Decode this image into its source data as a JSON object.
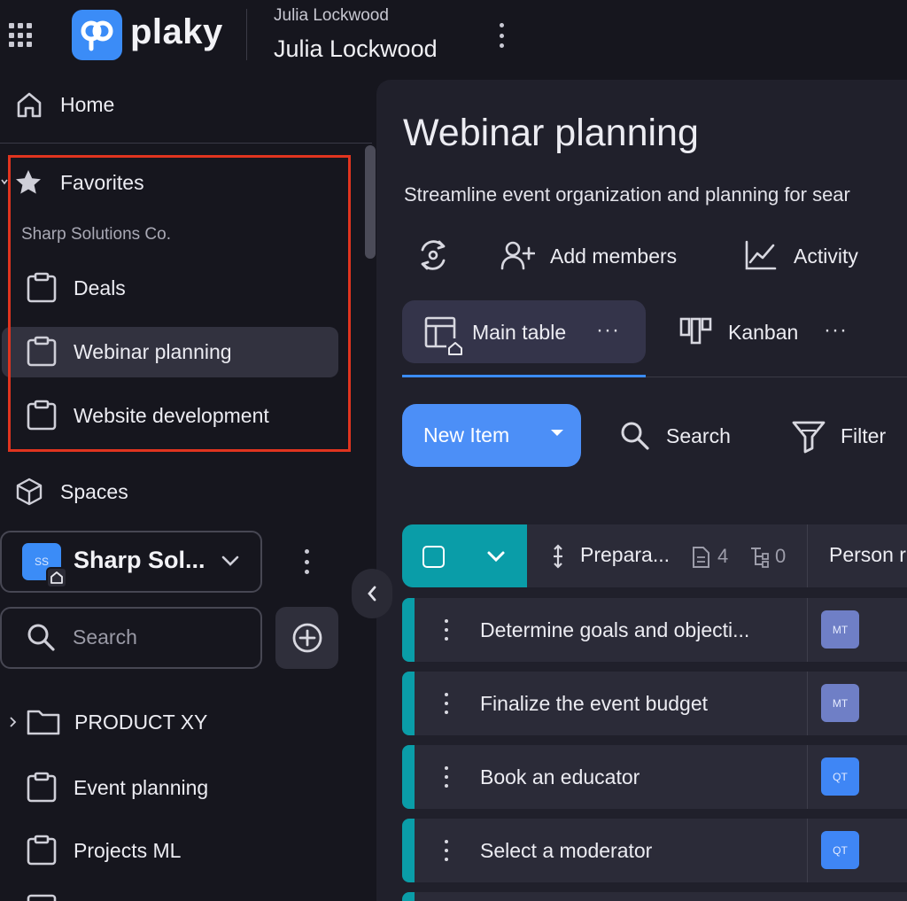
{
  "header": {
    "logo_text": "plaky",
    "user_small": "Julia Lockwood",
    "user_big": "Julia Lockwood"
  },
  "sidebar": {
    "home_label": "Home",
    "favorites_label": "Favorites",
    "favorites_workspace": "Sharp Solutions Co.",
    "favorites": [
      "Deals",
      "Webinar planning",
      "Website development"
    ],
    "spaces_label": "Spaces",
    "workspace": {
      "initials": "SS",
      "name": "Sharp Sol..."
    },
    "search_placeholder": "Search",
    "folder": "PRODUCT XY",
    "boards": [
      "Event planning",
      "Projects ML"
    ]
  },
  "main": {
    "title": "Webinar planning",
    "description": "Streamline event organization and planning for sear",
    "actions": {
      "add_members": "Add members",
      "activity": "Activity"
    },
    "views": [
      {
        "label": "Main table",
        "dots": "···"
      },
      {
        "label": "Kanban",
        "dots": "···"
      }
    ],
    "toolbar": {
      "new_item": "New Item",
      "search": "Search",
      "filter": "Filter"
    },
    "group": {
      "title": "Prepara...",
      "docs_count": "4",
      "subitems_count": "0",
      "person_header": "Person r"
    },
    "rows": [
      {
        "name": "Determine goals and objecti...",
        "avatar": "MT",
        "avatar_color": "#6f7fc6"
      },
      {
        "name": "Finalize the event budget",
        "avatar": "MT",
        "avatar_color": "#6f7fc6"
      },
      {
        "name": "Book an educator",
        "avatar": "QT",
        "avatar_color": "#3f86f5"
      },
      {
        "name": "Select a moderator",
        "avatar": "QT",
        "avatar_color": "#3f86f5"
      }
    ]
  },
  "colors": {
    "accent_blue": "#3b8cf7",
    "group_teal": "#0a9da8",
    "highlight_red": "#e0341f"
  }
}
